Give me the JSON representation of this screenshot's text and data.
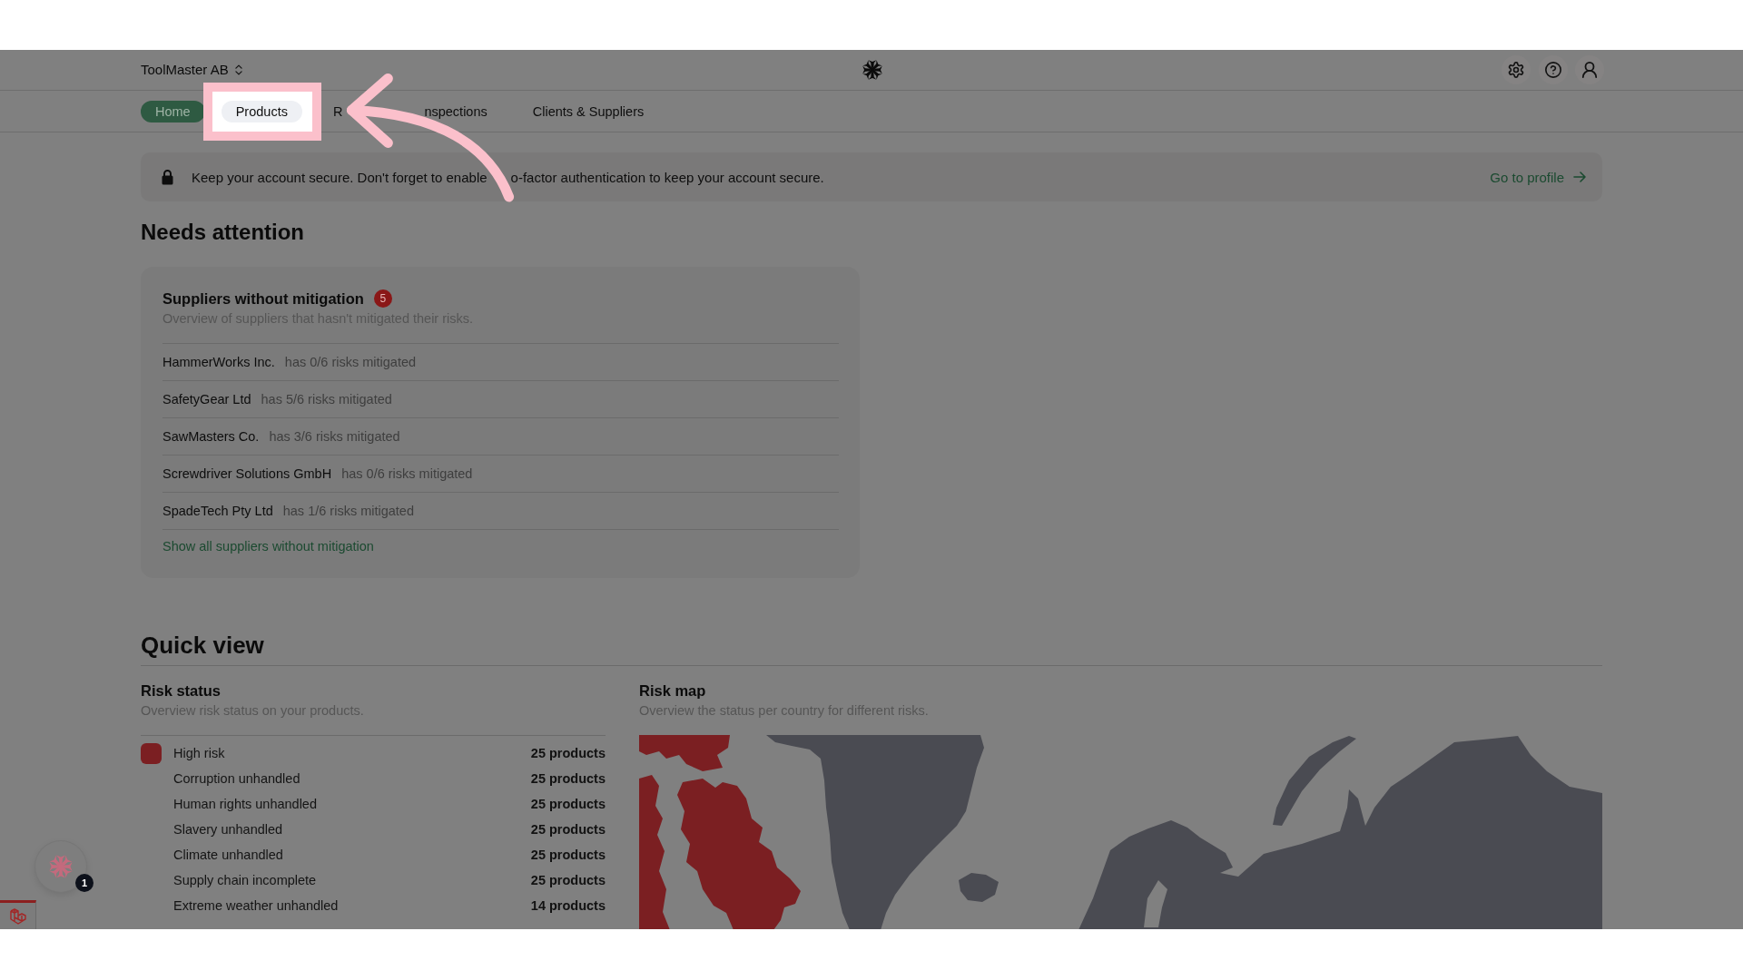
{
  "header": {
    "workspace": "ToolMaster AB"
  },
  "tabs": [
    {
      "label": "Home",
      "selected": true,
      "highlighted": false
    },
    {
      "label": "Products",
      "selected": false,
      "highlighted": true
    },
    {
      "label": "R",
      "selected": false,
      "highlighted": false
    },
    {
      "label": "nspections",
      "selected": false,
      "highlighted": false
    },
    {
      "label": "Clients & Suppliers",
      "selected": false,
      "highlighted": false
    }
  ],
  "banner": {
    "message": [
      "Keep your account secure. Don't forget to enable",
      "o-factor authentication to keep your account secure."
    ],
    "link": "Go to profile"
  },
  "needs_attention": {
    "title": "Needs attention",
    "card": {
      "title": "Suppliers without mitigation",
      "badge": "5",
      "subtitle": "Overview of suppliers that hasn't mitigated their risks.",
      "rows": [
        {
          "name": "HammerWorks Inc.",
          "status": "has 0/6 risks mitigated"
        },
        {
          "name": "SafetyGear Ltd",
          "status": "has 5/6 risks mitigated"
        },
        {
          "name": "SawMasters Co.",
          "status": "has 3/6 risks mitigated"
        },
        {
          "name": "Screwdriver Solutions GmbH",
          "status": "has 0/6 risks mitigated"
        },
        {
          "name": "SpadeTech Pty Ltd",
          "status": "has 1/6 risks mitigated"
        }
      ],
      "link": "Show all suppliers without mitigation"
    }
  },
  "quick_view": {
    "title": "Quick view",
    "risk_status": {
      "title": "Risk status",
      "subtitle": "Overview risk status on your products.",
      "rows": [
        {
          "kind": "category",
          "label": "High risk",
          "count": "25 products",
          "color": "#7b1f22"
        },
        {
          "kind": "item",
          "label": "Corruption unhandled",
          "count": "25 products"
        },
        {
          "kind": "item",
          "label": "Human rights unhandled",
          "count": "25 products"
        },
        {
          "kind": "item",
          "label": "Slavery unhandled",
          "count": "25 products"
        },
        {
          "kind": "item",
          "label": "Climate unhandled",
          "count": "25 products"
        },
        {
          "kind": "item",
          "label": "Supply chain incomplete",
          "count": "25 products"
        },
        {
          "kind": "item",
          "label": "Extreme weather unhandled",
          "count": "14 products"
        }
      ]
    },
    "risk_map": {
      "title": "Risk map",
      "subtitle": "Overview the status per country for different risks."
    }
  },
  "assistant": {
    "badge": "1"
  }
}
